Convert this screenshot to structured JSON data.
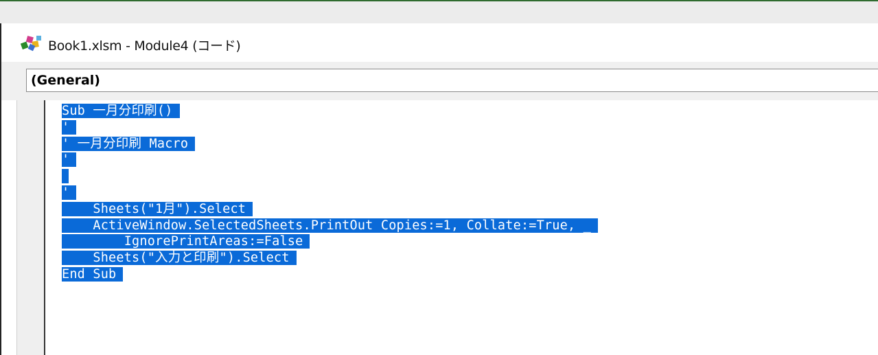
{
  "window": {
    "title": "Book1.xlsm - Module4 (コード)",
    "icon": "vba-project-icon"
  },
  "object_combo": {
    "value": "(General)"
  },
  "code": {
    "selection_color": "#0a6ad8",
    "lines": [
      "Sub 一月分印刷()",
      "'",
      "' 一月分印刷 Macro",
      "'",
      "",
      "'",
      "    Sheets(\"1月\").Select",
      "    ActiveWindow.SelectedSheets.PrintOut Copies:=1, Collate:=True, _",
      "        IgnorePrintAreas:=False",
      "    Sheets(\"入力と印刷\").Select",
      "End Sub"
    ]
  }
}
